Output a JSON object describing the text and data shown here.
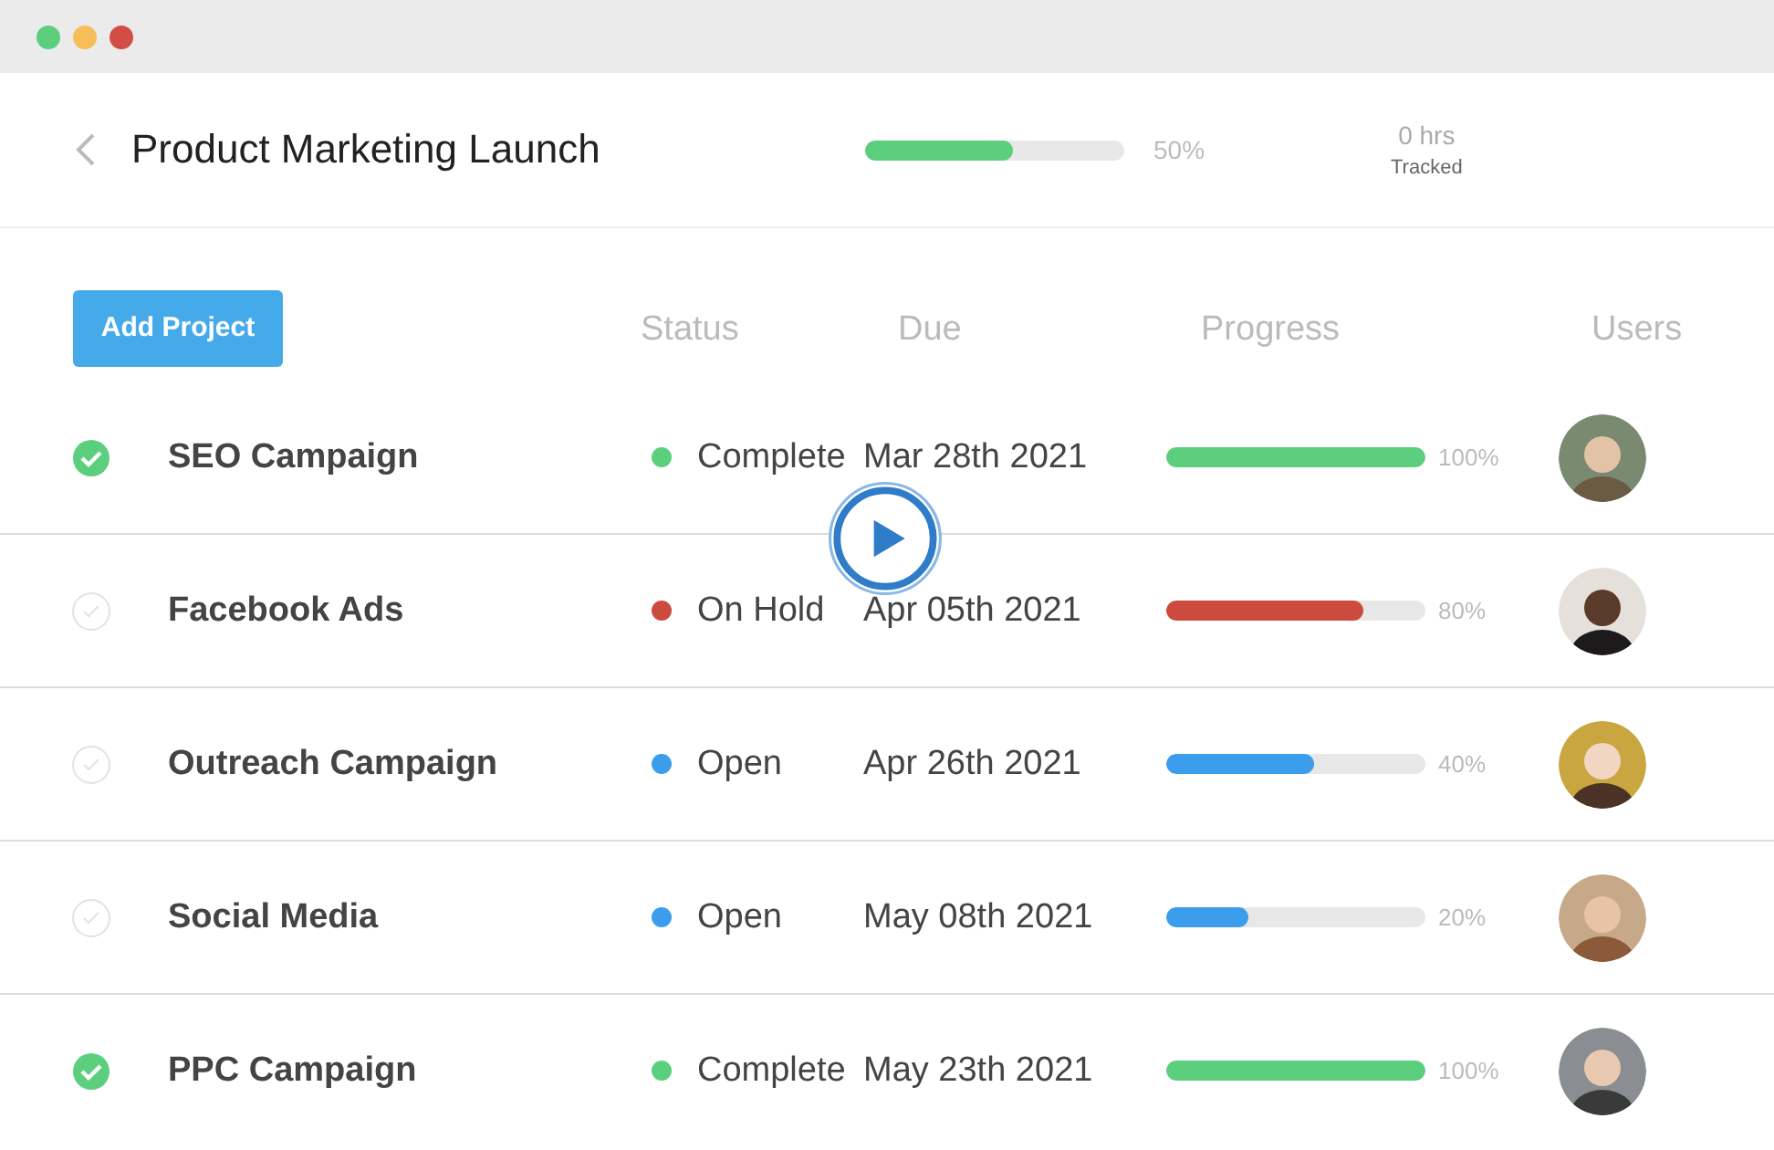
{
  "window": {
    "controls": [
      {
        "color": "#5ccf7e"
      },
      {
        "color": "#f5be58"
      },
      {
        "color": "#d24d45"
      }
    ]
  },
  "header": {
    "title": "Product Marketing Launch",
    "level": 0.57,
    "percent": "50%",
    "hours": "0 hrs",
    "hours_label": "Tracked"
  },
  "add_button": "Add Project",
  "columns": [
    "Status",
    "Due",
    "Progress",
    "Users"
  ],
  "rows": [
    {
      "checked": true,
      "name": "SEO Campaign",
      "status": "Complete",
      "color": "#5ccf7e",
      "due": "Mar 28th 2021",
      "level": 1.0,
      "percent": "100%"
    },
    {
      "checked": false,
      "name": "Facebook Ads",
      "status": "On Hold",
      "color": "#cd4a3f",
      "due": "Apr 05th 2021",
      "level": 0.76,
      "percent": "80%"
    },
    {
      "checked": false,
      "name": "Outreach Campaign",
      "status": "Open",
      "color": "#3d9ded",
      "due": "Apr 26th 2021",
      "level": 0.57,
      "percent": "40%"
    },
    {
      "checked": false,
      "name": "Social Media",
      "status": "Open",
      "color": "#3d9ded",
      "due": "May 08th 2021",
      "level": 0.32,
      "percent": "20%"
    },
    {
      "checked": true,
      "name": "PPC Campaign",
      "status": "Complete",
      "color": "#5ccf7e",
      "due": "May 23th 2021",
      "level": 1.0,
      "percent": "100%"
    }
  ],
  "video": {
    "kind": "play"
  }
}
